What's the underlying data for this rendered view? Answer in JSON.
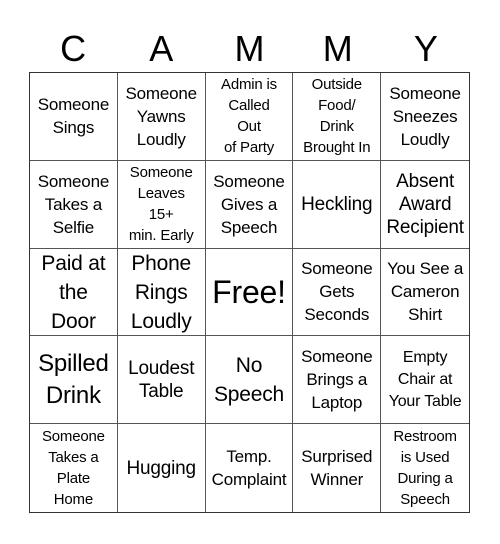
{
  "header": {
    "letters": [
      "C",
      "A",
      "M",
      "M",
      "Y"
    ]
  },
  "board": {
    "rows": [
      [
        {
          "text": "Someone\nSings",
          "size": "md"
        },
        {
          "text": "Someone\nYawns\nLoudly",
          "size": "md"
        },
        {
          "text": "Admin is\nCalled\nOut\nof Party",
          "size": "xs"
        },
        {
          "text": "Outside\nFood/\nDrink\nBrought In",
          "size": "xs"
        },
        {
          "text": "Someone\nSneezes\nLoudly",
          "size": "md"
        }
      ],
      [
        {
          "text": "Someone\nTakes a\nSelfie",
          "size": "md"
        },
        {
          "text": "Someone\nLeaves\n15+\nmin. Early",
          "size": "xs"
        },
        {
          "text": "Someone\nGives a\nSpeech",
          "size": "md"
        },
        {
          "text": "Heckling",
          "size": "lg"
        },
        {
          "text": "Absent\nAward\nRecipient",
          "size": "lg"
        }
      ],
      [
        {
          "text": "Paid at\nthe\nDoor",
          "size": "xl"
        },
        {
          "text": "Phone\nRings\nLoudly",
          "size": "xl"
        },
        {
          "text": "Free!",
          "size": "free"
        },
        {
          "text": "Someone\nGets\nSeconds",
          "size": "md"
        },
        {
          "text": "You See a\nCameron\nShirt",
          "size": "md"
        }
      ],
      [
        {
          "text": "Spilled\nDrink",
          "size": "xxl"
        },
        {
          "text": "Loudest\nTable",
          "size": "lg"
        },
        {
          "text": "No\nSpeech",
          "size": "xl"
        },
        {
          "text": "Someone\nBrings a\nLaptop",
          "size": "md"
        },
        {
          "text": "Empty\nChair at\nYour Table",
          "size": "sm"
        }
      ],
      [
        {
          "text": "Someone\nTakes a\nPlate\nHome",
          "size": "xs"
        },
        {
          "text": "Hugging",
          "size": "lg"
        },
        {
          "text": "Temp.\nComplaint",
          "size": "md"
        },
        {
          "text": "Surprised\nWinner",
          "size": "md"
        },
        {
          "text": "Restroom\nis Used\nDuring a\nSpeech",
          "size": "xs"
        }
      ]
    ]
  }
}
